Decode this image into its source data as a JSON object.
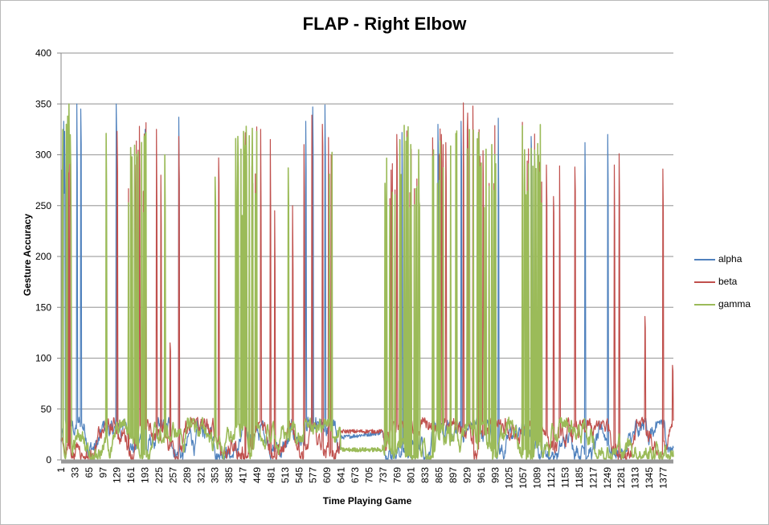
{
  "chart_data": {
    "type": "line",
    "title": "FLAP - Right Elbow",
    "xlabel": "Time Playing Game",
    "ylabel": "Gesture Accuracy",
    "ylim": [
      0,
      400
    ],
    "yticks": [
      0,
      50,
      100,
      150,
      200,
      250,
      300,
      350,
      400
    ],
    "x_range": [
      1,
      1400
    ],
    "xticks": [
      1,
      33,
      65,
      97,
      129,
      161,
      193,
      225,
      257,
      289,
      321,
      353,
      385,
      417,
      449,
      481,
      513,
      545,
      577,
      609,
      641,
      673,
      705,
      737,
      769,
      801,
      833,
      865,
      897,
      929,
      961,
      993,
      1025,
      1057,
      1089,
      1121,
      1153,
      1185,
      1217,
      1249,
      1281,
      1313,
      1345,
      1377
    ],
    "grid": "horizontal",
    "legend_position": "right",
    "series": [
      {
        "name": "alpha",
        "color": "#4f81bd"
      },
      {
        "name": "beta",
        "color": "#c0504d"
      },
      {
        "name": "gamma",
        "color": "#9bbb59"
      }
    ],
    "baseline_note": "Between spikes all three series fluctuate roughly between 0 and 40.",
    "flat_segment": {
      "x": [
        640,
        735
      ],
      "alpha": 22,
      "beta": 28,
      "gamma": 10
    },
    "spikes": [
      {
        "x": 3,
        "gamma": 285
      },
      {
        "x": 7,
        "alpha": 333
      },
      {
        "x": 9,
        "alpha": 323
      },
      {
        "x": 13,
        "gamma": 330
      },
      {
        "x": 16,
        "gamma": 338
      },
      {
        "x": 19,
        "gamma": 350
      },
      {
        "x": 21,
        "gamma": 345
      },
      {
        "x": 23,
        "gamma": 262
      },
      {
        "x": 37,
        "alpha": 350
      },
      {
        "x": 46,
        "alpha": 345
      },
      {
        "x": 104,
        "gamma": 321
      },
      {
        "x": 127,
        "alpha": 350
      },
      {
        "x": 129,
        "beta": 323
      },
      {
        "x": 160,
        "gamma": 307
      },
      {
        "x": 163,
        "gamma": 300
      },
      {
        "x": 170,
        "beta": 290
      },
      {
        "x": 176,
        "beta": 297
      },
      {
        "x": 180,
        "beta": 328
      },
      {
        "x": 193,
        "alpha": 325
      },
      {
        "x": 193,
        "gamma": 320
      },
      {
        "x": 219,
        "beta": 325
      },
      {
        "x": 229,
        "beta": 280
      },
      {
        "x": 238,
        "gamma": 300
      },
      {
        "x": 250,
        "beta": 115
      },
      {
        "x": 270,
        "alpha": 337
      },
      {
        "x": 270,
        "beta": 318
      },
      {
        "x": 353,
        "gamma": 278
      },
      {
        "x": 361,
        "beta": 297
      },
      {
        "x": 400,
        "gamma": 316
      },
      {
        "x": 405,
        "gamma": 318
      },
      {
        "x": 418,
        "gamma": 323
      },
      {
        "x": 424,
        "gamma": 328
      },
      {
        "x": 438,
        "gamma": 326
      },
      {
        "x": 445,
        "gamma": 318
      },
      {
        "x": 457,
        "beta": 325
      },
      {
        "x": 479,
        "beta": 315
      },
      {
        "x": 489,
        "beta": 245
      },
      {
        "x": 520,
        "gamma": 287
      },
      {
        "x": 530,
        "beta": 250
      },
      {
        "x": 556,
        "beta": 310
      },
      {
        "x": 560,
        "alpha": 333
      },
      {
        "x": 574,
        "beta": 339
      },
      {
        "x": 576,
        "alpha": 347
      },
      {
        "x": 598,
        "beta": 330
      },
      {
        "x": 604,
        "alpha": 349
      },
      {
        "x": 612,
        "beta": 317
      },
      {
        "x": 618,
        "beta": 300
      },
      {
        "x": 741,
        "gamma": 272
      },
      {
        "x": 755,
        "beta": 285
      },
      {
        "x": 768,
        "beta": 320
      },
      {
        "x": 780,
        "alpha": 322
      },
      {
        "x": 800,
        "gamma": 310
      },
      {
        "x": 818,
        "gamma": 305
      },
      {
        "x": 850,
        "beta": 325
      },
      {
        "x": 862,
        "alpha": 330
      },
      {
        "x": 870,
        "beta": 320
      },
      {
        "x": 880,
        "beta": 312
      },
      {
        "x": 915,
        "alpha": 333
      },
      {
        "x": 920,
        "beta": 351
      },
      {
        "x": 930,
        "beta": 341
      },
      {
        "x": 942,
        "beta": 348
      },
      {
        "x": 955,
        "gamma": 322
      },
      {
        "x": 965,
        "beta": 304
      },
      {
        "x": 985,
        "gamma": 310
      },
      {
        "x": 1000,
        "alpha": 336
      },
      {
        "x": 1060,
        "gamma": 305
      },
      {
        "x": 1075,
        "alpha": 318
      },
      {
        "x": 1083,
        "gamma": 314
      },
      {
        "x": 1092,
        "beta": 275
      },
      {
        "x": 1110,
        "beta": 290
      },
      {
        "x": 1126,
        "beta": 259
      },
      {
        "x": 1140,
        "beta": 289
      },
      {
        "x": 1175,
        "beta": 288
      },
      {
        "x": 1198,
        "alpha": 312
      },
      {
        "x": 1250,
        "alpha": 320
      },
      {
        "x": 1265,
        "beta": 290
      },
      {
        "x": 1276,
        "beta": 301
      },
      {
        "x": 1335,
        "beta": 141
      },
      {
        "x": 1376,
        "beta": 286
      },
      {
        "x": 1398,
        "beta": 93
      }
    ]
  }
}
